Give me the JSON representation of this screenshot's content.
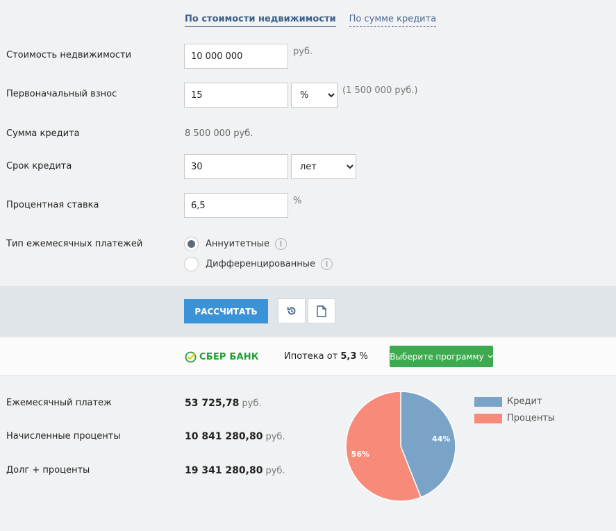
{
  "tabs": [
    {
      "label": "По стоимости недвижимости",
      "active": true
    },
    {
      "label": "По сумме кредита",
      "active": false
    }
  ],
  "form": {
    "property_cost": {
      "label": "Стоимость недвижимости",
      "value": "10 000 000",
      "unit": "руб."
    },
    "down_payment": {
      "label": "Первоначальный взнос",
      "value": "15",
      "select": "%",
      "note": "(1 500 000 руб.)"
    },
    "loan_sum": {
      "label": "Сумма кредита",
      "value": "8 500 000  руб."
    },
    "term": {
      "label": "Срок кредита",
      "value": "30",
      "select": "лет"
    },
    "rate": {
      "label": "Процентная ставка",
      "value": "6,5",
      "unit": "%"
    },
    "payment_type": {
      "label": "Тип ежемесячных платежей",
      "options": [
        {
          "label": "Аннуитетные",
          "selected": true
        },
        {
          "label": "Дифференцированные",
          "selected": false
        }
      ]
    }
  },
  "actions": {
    "calculate_label": "РАССЧИТАТЬ",
    "reset_icon": "reset-icon",
    "document_icon": "document-icon"
  },
  "bank": {
    "name": "СБЕР БАНК",
    "mortgage_prefix": "Ипотека от",
    "mortgage_rate": "5,3",
    "mortgage_suffix": "%",
    "program_button": "Выберите программу"
  },
  "results": {
    "monthly_payment": {
      "label": "Ежемесячный платеж",
      "value": "53 725,78",
      "unit": "руб."
    },
    "interest": {
      "label": "Начисленные проценты",
      "value": "10 841 280,80",
      "unit": "руб."
    },
    "total": {
      "label": "Долг + проценты",
      "value": "19 341 280,80",
      "unit": "руб."
    }
  },
  "chart_data": {
    "type": "pie",
    "slices": [
      {
        "name": "Кредит",
        "value": 44,
        "label": "44%",
        "color": "#7aa3c8"
      },
      {
        "name": "Проценты",
        "value": 56,
        "label": "56%",
        "color": "#f88a7a"
      }
    ],
    "legend_position": "right"
  },
  "colors": {
    "accent_blue": "#3a92d7",
    "sber_green": "#21a038",
    "program_green": "#3eaa50"
  }
}
